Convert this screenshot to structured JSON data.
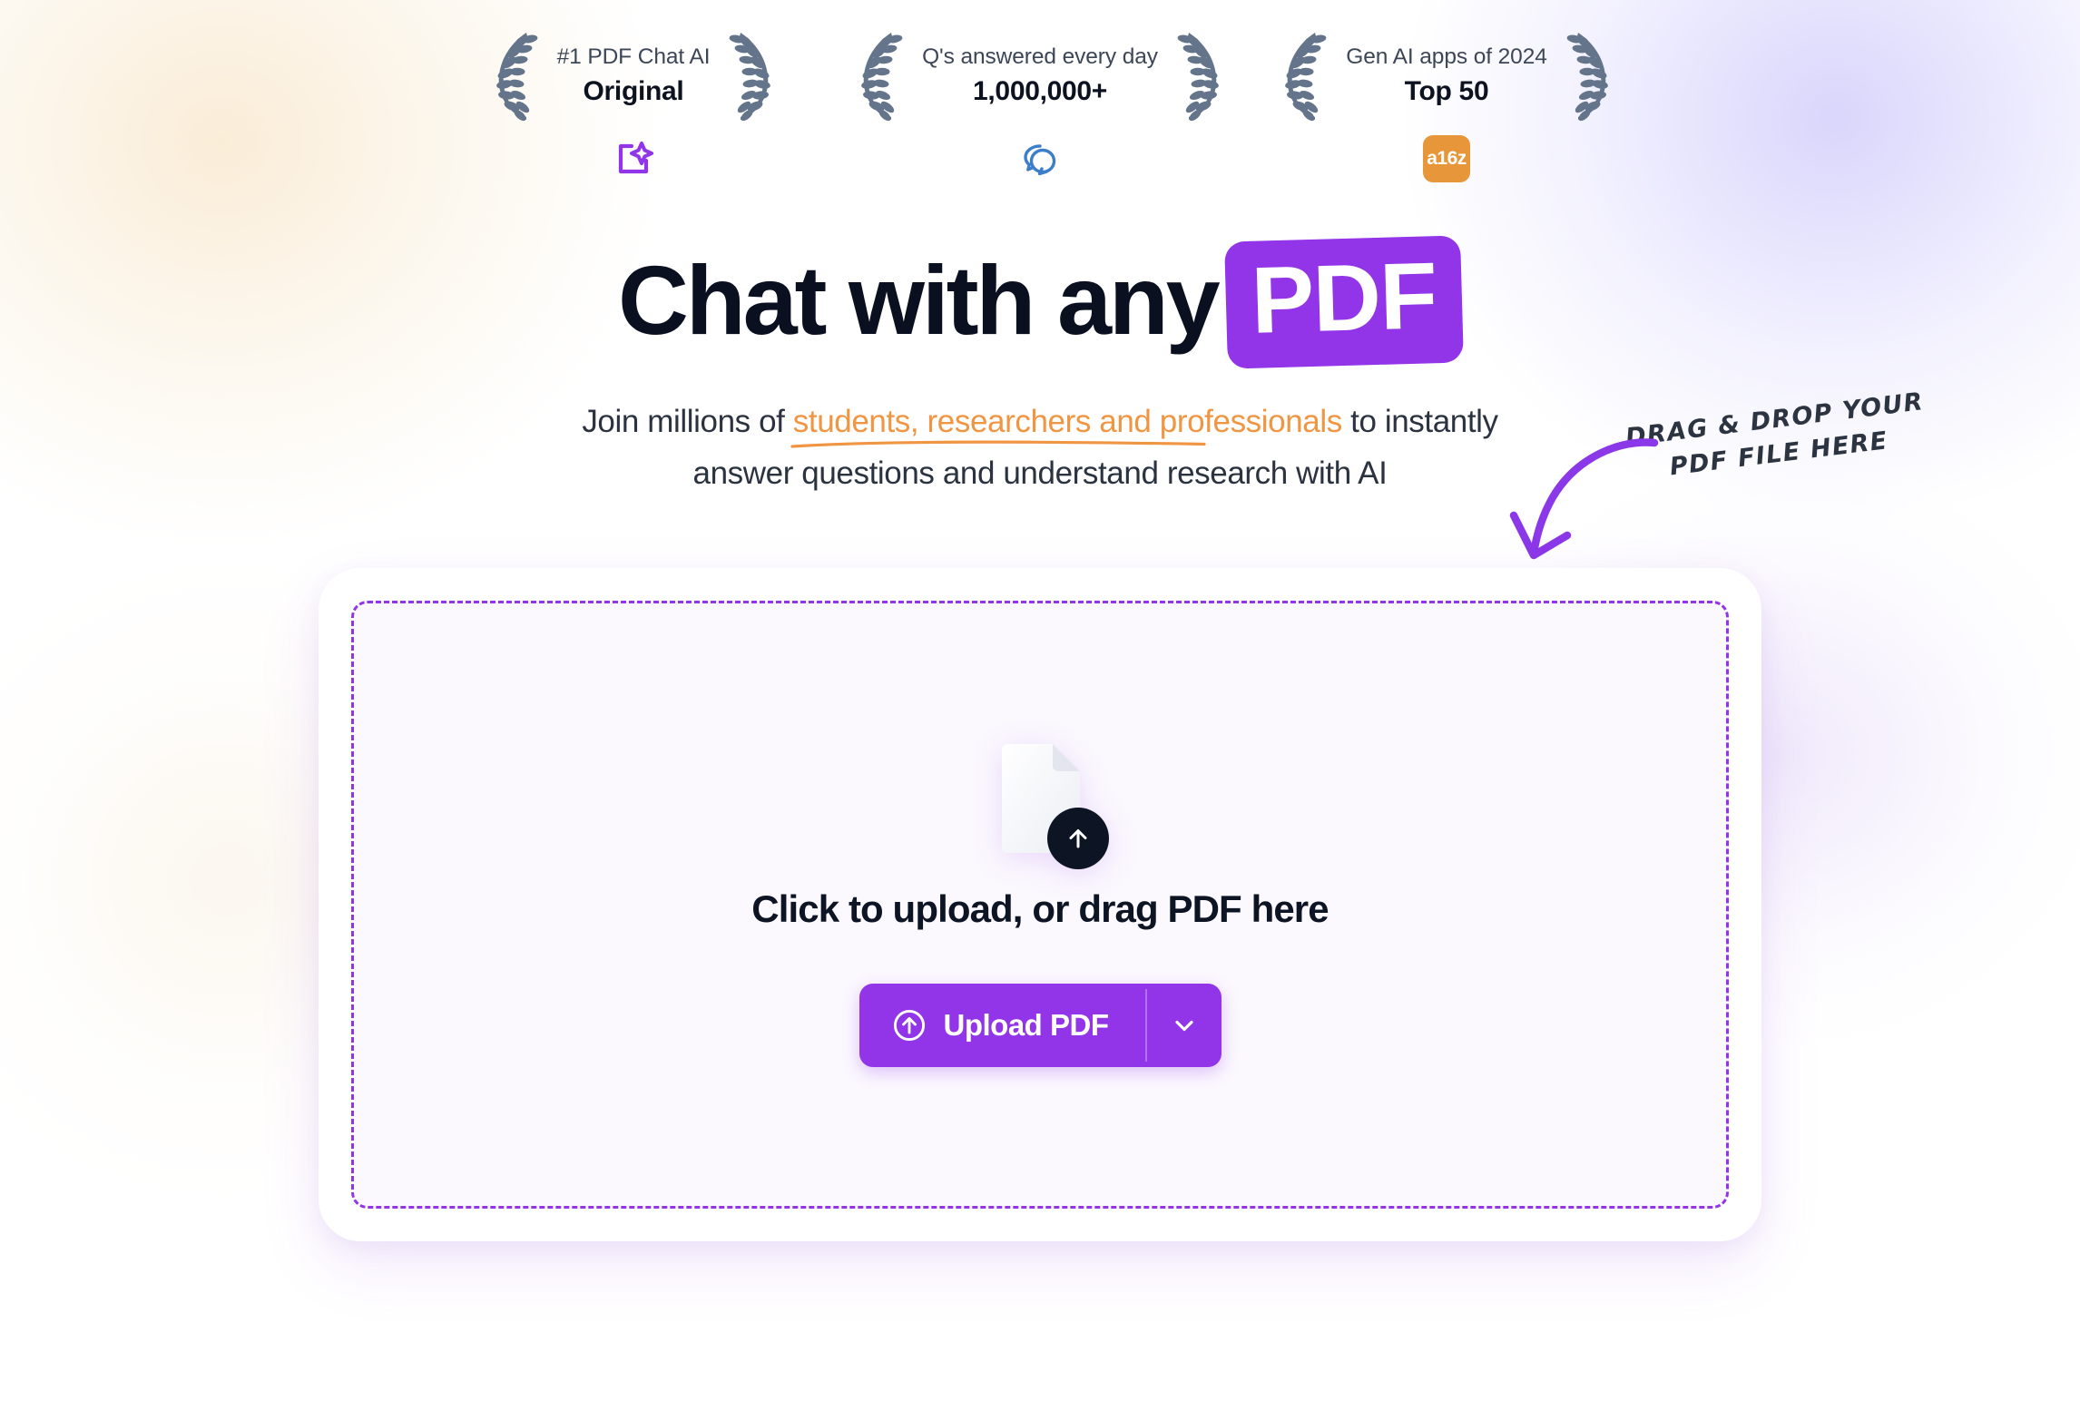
{
  "theme": {
    "accent_purple": "#9234e8",
    "accent_orange": "#f09542",
    "ink": "#0b1020",
    "laurel_gray": "#64748b",
    "a16z_orange": "#e8963a",
    "quora_blue": "#3d7ec9",
    "dropzone_bg": "#fbf8fe"
  },
  "awards": [
    {
      "label": "#1 PDF Chat AI",
      "value": "Original",
      "logo_icon": "sparkle-document-icon",
      "logo_text": ""
    },
    {
      "label": "Q's answered every day",
      "value": "1,000,000+",
      "logo_icon": "quora-chat-bubbles-icon",
      "logo_text": ""
    },
    {
      "label": "Gen AI apps of 2024",
      "value": "Top 50",
      "logo_icon": "a16z-logo-icon",
      "logo_text": "a16z"
    }
  ],
  "hero": {
    "headline_prefix": "Chat with any",
    "headline_badge": "PDF",
    "subtitle_before": "Join millions of ",
    "subtitle_highlight": "students, researchers and professionals",
    "subtitle_after": " to instantly",
    "subtitle_line2": "answer questions and understand research with AI"
  },
  "annotation": {
    "text": "Drag & drop your\nPDF file here",
    "arrow_icon": "curved-arrow-down-left-icon"
  },
  "dropzone": {
    "file_icon": "document-upload-icon",
    "upload_arrow_icon": "arrow-up-icon",
    "title": "Click to upload, or drag PDF here",
    "upload_button_label": "Upload PDF",
    "upload_button_icon": "circle-arrow-up-icon",
    "dropdown_icon": "chevron-down-icon"
  }
}
